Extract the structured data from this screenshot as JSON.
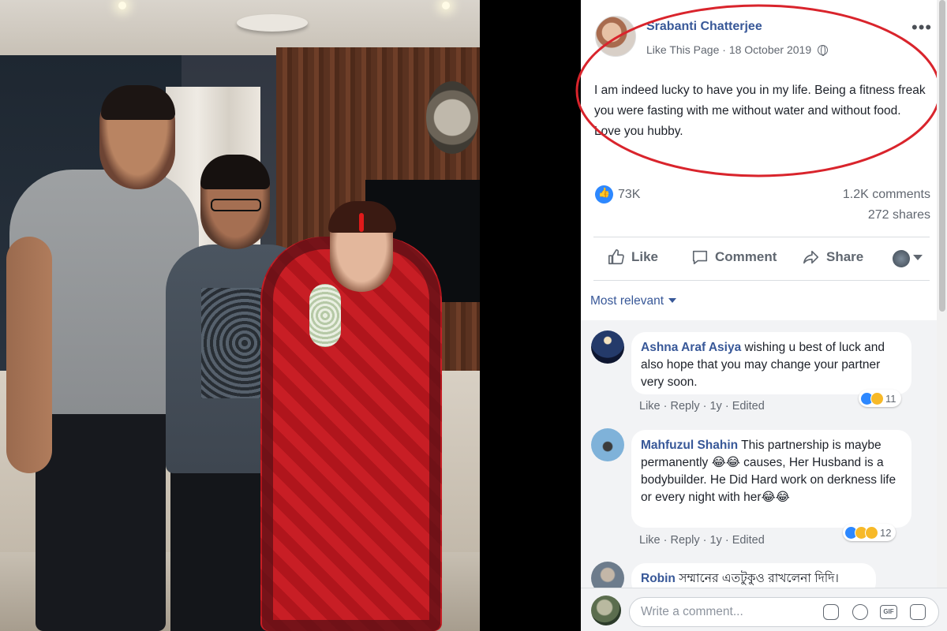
{
  "post": {
    "author": "Srabanti Chatterjee",
    "like_page": "Like This Page",
    "separator": "·",
    "date": "18 October 2019",
    "text": "I am indeed lucky to have you in my life. Being a fitness freak you were fasting with me without water and without food. Love you hubby.",
    "reactions_count": "73K",
    "comments_count": "1.2K comments",
    "shares_count": "272 shares"
  },
  "actions": {
    "like": "Like",
    "comment": "Comment",
    "share": "Share"
  },
  "sort": {
    "label": "Most relevant"
  },
  "comments": [
    {
      "name": "Ashna Araf Asiya",
      "text": "wishing u best of luck and also hope that you may change your partner very soon.",
      "like": "Like",
      "reply": "Reply",
      "age": "1y",
      "edited": "Edited",
      "reaction_count": "11"
    },
    {
      "name": "Mahfuzul Shahin",
      "text": "This partnership is maybe permanently 😂😂 causes, Her Husband is a bodybuilder. He Did Hard work on derkness life or every night with her😂😂",
      "like": "Like",
      "reply": "Reply",
      "age": "1y",
      "edited": "Edited",
      "reaction_count": "12"
    },
    {
      "name": "Robin",
      "text": "সম্মানের এতটুকুও রাখলেনা দিদি।"
    }
  ],
  "composer": {
    "placeholder": "Write a comment..."
  },
  "colors": {
    "accent": "#385898",
    "highlight_ellipse": "#d9242c",
    "like_blue": "#2d88ff"
  }
}
